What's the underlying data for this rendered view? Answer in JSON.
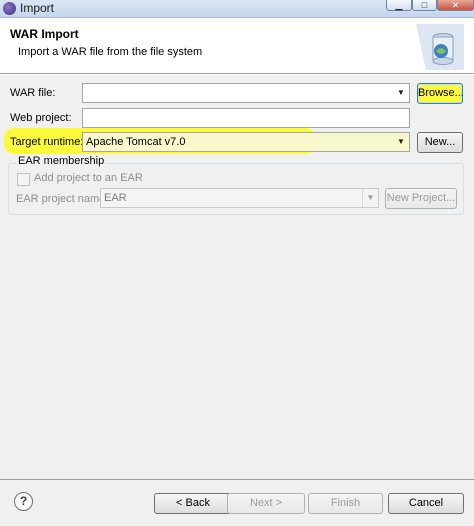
{
  "window": {
    "title": "Import",
    "minimize_glyph": "▁",
    "maximize_glyph": "□",
    "close_glyph": "✕"
  },
  "header": {
    "title": "WAR Import",
    "description": "Import a WAR file from the file system",
    "icon": "wizard-banner-icon"
  },
  "form": {
    "war_file_label": "WAR file:",
    "war_file_value": "",
    "browse_button": "Browse...",
    "web_project_label": "Web project:",
    "web_project_value": "",
    "target_runtime_label": "Target runtime:",
    "target_runtime_value": "Apache Tomcat v7.0",
    "new_button": "New...",
    "dropdown_glyph": "▼"
  },
  "ear": {
    "group_title": "EAR membership",
    "add_to_ear_label": "Add project to an EAR",
    "add_to_ear_checked": false,
    "ear_project_label": "EAR project name:",
    "ear_project_value": "EAR",
    "new_project_button": "New Project..."
  },
  "footer": {
    "help_glyph": "?",
    "back_button": "< Back",
    "next_button": "Next >",
    "finish_button": "Finish",
    "cancel_button": "Cancel"
  },
  "colors": {
    "highlight": "#ffff00",
    "dialog_background": "#f0f0f0",
    "title_bar": "#c5d6ec"
  }
}
